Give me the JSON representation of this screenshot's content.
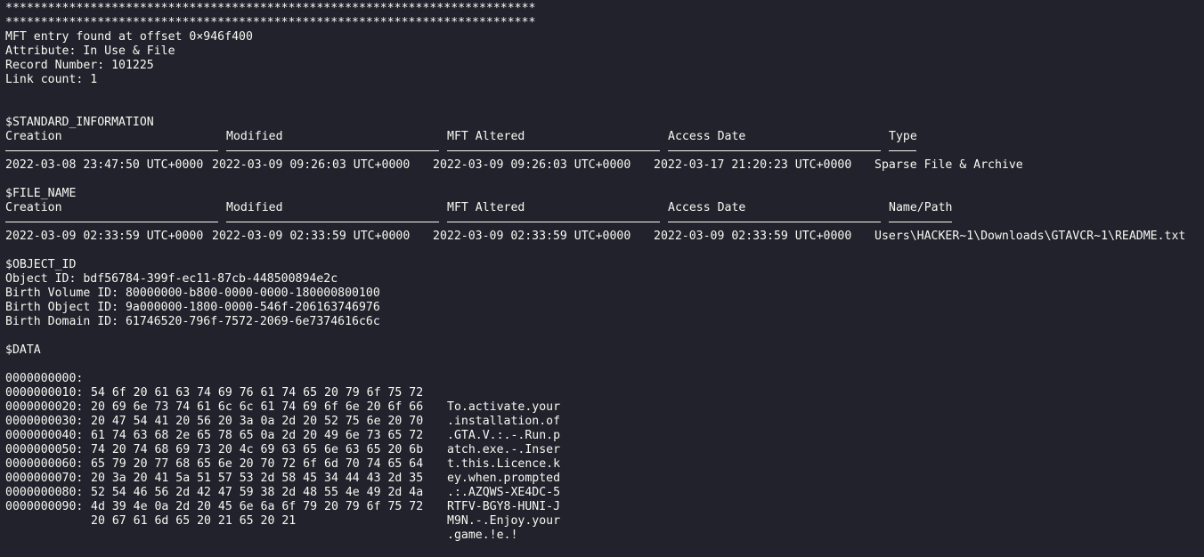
{
  "banner": {
    "line1": "***************************************************************************",
    "line2": "***************************************************************************"
  },
  "entry": {
    "offset_line": "MFT entry found at offset 0×946f400",
    "attribute_line": "Attribute: In Use & File",
    "record_line": "Record Number: 101225",
    "link_line": "Link count: 1"
  },
  "standard_information": {
    "title": "$STANDARD_INFORMATION",
    "headers": [
      "Creation",
      "Modified",
      "MFT Altered",
      "Access Date",
      "Type"
    ],
    "values": [
      "2022-03-08 23:47:50 UTC+0000",
      "2022-03-09 09:26:03 UTC+0000",
      "2022-03-09 09:26:03 UTC+0000",
      "2022-03-17 21:20:23 UTC+0000",
      "Sparse File & Archive"
    ]
  },
  "file_name": {
    "title": "$FILE_NAME",
    "headers": [
      "Creation",
      "Modified",
      "MFT Altered",
      "Access Date",
      "Name/Path"
    ],
    "values": [
      "2022-03-09 02:33:59 UTC+0000",
      "2022-03-09 02:33:59 UTC+0000",
      "2022-03-09 02:33:59 UTC+0000",
      "2022-03-09 02:33:59 UTC+0000",
      "Users\\HACKER~1\\Downloads\\GTAVCR~1\\README.txt"
    ]
  },
  "object_id": {
    "title": "$OBJECT_ID",
    "object_id_line": "Object ID: bdf56784-399f-ec11-87cb-448500894e2c",
    "birth_volume_line": "Birth Volume ID: 80000000-b800-0000-0000-180000800100",
    "birth_object_line": "Birth Object ID: 9a000000-1800-0000-546f-206163746976",
    "birth_domain_line": "Birth Domain ID: 61746520-796f-7572-2069-6e7374616c6c"
  },
  "data": {
    "title": "$DATA",
    "rows": [
      {
        "addr": "0000000000:",
        "hex": "54 6f 20 61 63 74 69 76 61 74 65 20 79 6f 75 72",
        "ascii": "To.activate.your"
      },
      {
        "addr": "0000000010:",
        "hex": "20 69 6e 73 74 61 6c 6c 61 74 69 6f 6e 20 6f 66",
        "ascii": ".installation.of"
      },
      {
        "addr": "0000000020:",
        "hex": "20 47 54 41 20 56 20 3a 0a 2d 20 52 75 6e 20 70",
        "ascii": ".GTA.V.:.-.Run.p"
      },
      {
        "addr": "0000000030:",
        "hex": "61 74 63 68 2e 65 78 65 0a 2d 20 49 6e 73 65 72",
        "ascii": "atch.exe.-.Inser"
      },
      {
        "addr": "0000000040:",
        "hex": "74 20 74 68 69 73 20 4c 69 63 65 6e 63 65 20 6b",
        "ascii": "t.this.Licence.k"
      },
      {
        "addr": "0000000050:",
        "hex": "65 79 20 77 68 65 6e 20 70 72 6f 6d 70 74 65 64",
        "ascii": "ey.when.prompted"
      },
      {
        "addr": "0000000060:",
        "hex": "20 3a 20 41 5a 51 57 53 2d 58 45 34 44 43 2d 35",
        "ascii": ".:.AZQWS-XE4DC-5"
      },
      {
        "addr": "0000000070:",
        "hex": "52 54 46 56 2d 42 47 59 38 2d 48 55 4e 49 2d 4a",
        "ascii": "RTFV-BGY8-HUNI-J"
      },
      {
        "addr": "0000000080:",
        "hex": "4d 39 4e 0a 2d 20 45 6e 6a 6f 79 20 79 6f 75 72",
        "ascii": "M9N.-.Enjoy.your"
      },
      {
        "addr": "0000000090:",
        "hex": "20 67 61 6d 65 20 21 65 20 21",
        "ascii": ".game.!e.!"
      }
    ]
  }
}
